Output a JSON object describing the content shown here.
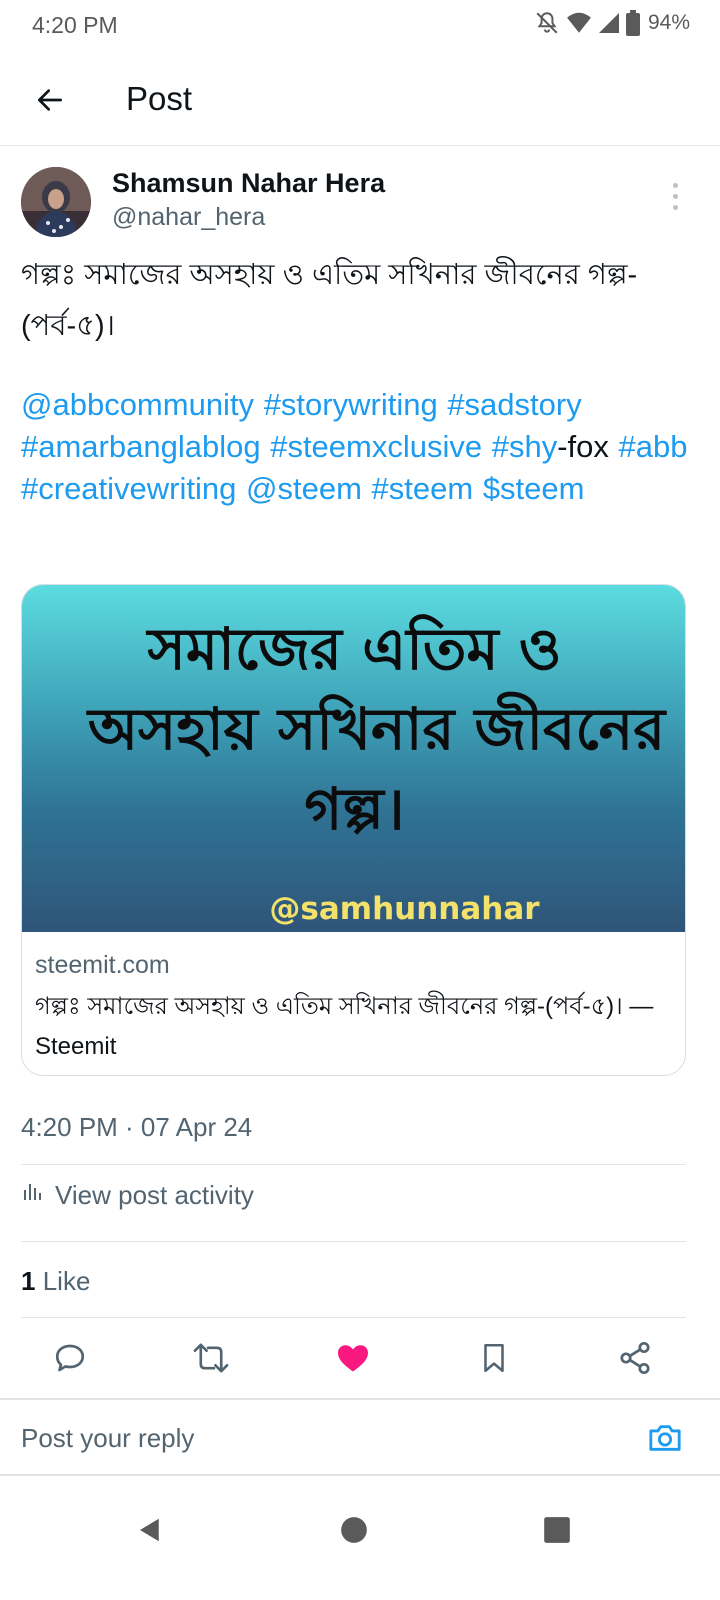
{
  "status_bar": {
    "time": "4:20 PM",
    "battery": "94%",
    "icons": [
      "bell-off-icon",
      "wifi-icon",
      "signal-icon",
      "battery-icon"
    ]
  },
  "header": {
    "title": "Post",
    "back_icon": "arrow-left-icon"
  },
  "post": {
    "author_name": "Shamsun Nahar Hera",
    "author_handle": "@nahar_hera",
    "text": "গল্পঃ সমাজের অসহায় ও এতিম সখিনার জীবনের গল্প-(পর্ব-৫)।",
    "tags": [
      {
        "text": "@abbcommunity",
        "link": true
      },
      {
        "text": "#storywriting",
        "link": true
      },
      {
        "text": "#sadstory",
        "link": true
      },
      {
        "text": "#amarbanglablog",
        "link": true
      },
      {
        "text": "#steemxclusive",
        "link": true
      },
      {
        "text": "#shy",
        "link": true
      },
      {
        "text": "-fox",
        "link": false
      },
      {
        "text": "#abb",
        "link": true
      },
      {
        "text": "#creativewriting",
        "link": true
      },
      {
        "text": "@steem",
        "link": true
      },
      {
        "text": "#steem",
        "link": true
      },
      {
        "text": "$steem",
        "link": true
      }
    ],
    "card": {
      "image_line1": "সমাজের এতিম ও",
      "image_line2": "অসহায় সখিনার জীবনের",
      "image_line3": "গল্প।",
      "image_credit": "@samhunnahar",
      "domain": "steemit.com",
      "title": "গল্পঃ সমাজের অসহায় ও এতিম সখিনার জীবনের গল্প-(পর্ব-৫)। — Steemit"
    },
    "timestamp": "4:20 PM · 07 Apr 24",
    "activity_label": "View post activity",
    "likes_count": "1",
    "likes_label": "Like"
  },
  "actions": [
    "reply-icon",
    "retweet-icon",
    "heart-filled-icon",
    "bookmark-icon",
    "share-icon"
  ],
  "reply": {
    "placeholder": "Post your reply"
  },
  "colors": {
    "link": "#1d9bf0",
    "like": "#f91880",
    "text": "#0f1419",
    "secondary": "#536471"
  }
}
